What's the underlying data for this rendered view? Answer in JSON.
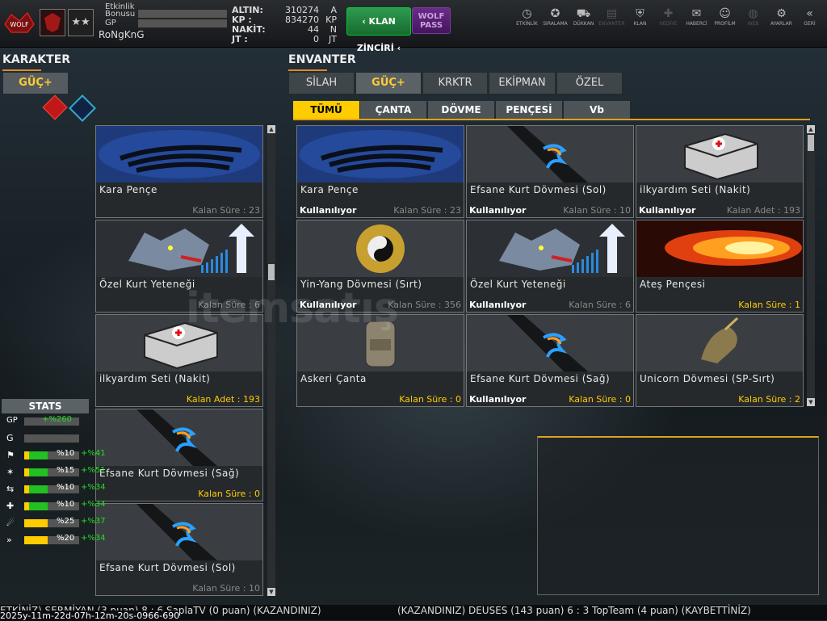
{
  "header": {
    "bonus_label": "Etkinlik\nBonusu",
    "gp_label": "GP",
    "username": "RoNgKnG",
    "currencies": [
      {
        "label": "ALTIN:",
        "value": "310274",
        "unit": "A"
      },
      {
        "label": "KP :",
        "value": "834270",
        "unit": "KP"
      },
      {
        "label": "NAKİT:",
        "value": "44",
        "unit": "N"
      },
      {
        "label": "JT :",
        "value": "0",
        "unit": "JT"
      }
    ],
    "klan_button": "‹ KLAN ZİNCİRİ ‹",
    "wolf_button": "WOLF\nPASS",
    "icons": [
      {
        "label": "ETKİNLİK",
        "icon": "clock-icon",
        "glyph": "◷",
        "dim": false
      },
      {
        "label": "SIRALAMA",
        "icon": "medal-icon",
        "glyph": "✪",
        "dim": false
      },
      {
        "label": "DÜKKAN",
        "icon": "cart-icon",
        "glyph": "⛟",
        "dim": false
      },
      {
        "label": "ENVANTER",
        "icon": "inventory-icon",
        "glyph": "▤",
        "dim": true
      },
      {
        "label": "KLAN",
        "icon": "shield-icon",
        "glyph": "⛨",
        "dim": false
      },
      {
        "label": "HEDİYE",
        "icon": "gift-icon",
        "glyph": "✚",
        "dim": true
      },
      {
        "label": "HABERCİ",
        "icon": "megaphone-icon",
        "glyph": "✉",
        "dim": false
      },
      {
        "label": "PROFİLM",
        "icon": "profile-icon",
        "glyph": "☺",
        "dim": false
      },
      {
        "label": "WEB",
        "icon": "globe-icon",
        "glyph": "◍",
        "dim": true
      },
      {
        "label": "AYARLAR",
        "icon": "gear-icon",
        "glyph": "⚙",
        "dim": false
      },
      {
        "label": "GERİ",
        "icon": "back-icon",
        "glyph": "«",
        "dim": false
      }
    ]
  },
  "karakter": {
    "title": "KARAKTER",
    "tab": "GÜÇ+",
    "cards": [
      {
        "name": "Kara Pençe",
        "remaining": "Kalan Süre : 23",
        "yellow": false,
        "img": "claw"
      },
      {
        "name": "Özel Kurt Yeteneği",
        "remaining": "Kalan Süre : 6",
        "yellow": false,
        "img": "wolf"
      },
      {
        "name": "ilkyardım Seti (Nakit)",
        "remaining": "Kalan Adet : 193",
        "yellow": true,
        "img": "medkit"
      },
      {
        "name": "Efsane Kurt Dövmesi (Sağ)",
        "remaining": "Kalan Süre : 0",
        "yellow": true,
        "img": "tattoo"
      },
      {
        "name": "Efsane Kurt Dövmesi (Sol)",
        "remaining": "Kalan Süre : 10",
        "yellow": false,
        "img": "tattoo"
      }
    ]
  },
  "stats": {
    "title": "STATS",
    "rows": [
      {
        "icon": "GP",
        "pct": "+%260",
        "plus": "",
        "fill": 0,
        "color": "#1c3",
        "type": "gp"
      },
      {
        "icon": "G",
        "pct": "",
        "plus": "",
        "fill": 0,
        "color": "#1c3",
        "type": "g"
      },
      {
        "icon": "⚑",
        "pct": "%10",
        "plus": "+%41",
        "fill": 0.42,
        "color": "#22c022",
        "type": "stat"
      },
      {
        "icon": "✶",
        "pct": "%15",
        "plus": "+%51",
        "fill": 0.42,
        "color": "#22c022",
        "type": "stat"
      },
      {
        "icon": "⇆",
        "pct": "%10",
        "plus": "+%34",
        "fill": 0.42,
        "color": "#22c022",
        "type": "stat"
      },
      {
        "icon": "✚",
        "pct": "%10",
        "plus": "+%34",
        "fill": 0.42,
        "color": "#22c022",
        "type": "stat"
      },
      {
        "icon": "☄",
        "pct": "%25",
        "plus": "+%37",
        "fill": 0.42,
        "color": "#ffcc00",
        "type": "stat"
      },
      {
        "icon": "»",
        "pct": "%20",
        "plus": "+%34",
        "fill": 0.42,
        "color": "#ffcc00",
        "type": "stat"
      }
    ]
  },
  "envanter": {
    "title": "ENVANTER",
    "tabs": [
      "SİLAH",
      "GÜÇ+",
      "KRKTR",
      "EKİPMAN",
      "ÖZEL"
    ],
    "active_tab": 1,
    "subtabs": [
      "TÜMÜ",
      "ÇANTA",
      "DÖVME",
      "PENÇESİ",
      "Vb"
    ],
    "active_subtab": 0,
    "items": [
      {
        "name": "Kara Pençe",
        "status": "Kullanılıyor",
        "remaining": "Kalan Süre : 23",
        "yellow": false,
        "img": "claw"
      },
      {
        "name": "Efsane Kurt Dövmesi (Sol)",
        "status": "Kullanılıyor",
        "remaining": "Kalan Süre : 10",
        "yellow": false,
        "img": "tattoo"
      },
      {
        "name": "ilkyardım Seti (Nakit)",
        "status": "Kullanılıyor",
        "remaining": "Kalan Adet : 193",
        "yellow": false,
        "img": "medkit"
      },
      {
        "name": "Yin-Yang Dövmesi (Sırt)",
        "status": "Kullanılıyor",
        "remaining": "Kalan Süre : 356",
        "yellow": false,
        "img": "dragon"
      },
      {
        "name": "Özel Kurt Yeteneği",
        "status": "Kullanılıyor",
        "remaining": "Kalan Süre : 6",
        "yellow": false,
        "img": "wolf"
      },
      {
        "name": "Ateş Pençesi",
        "status": "",
        "remaining": "Kalan Süre : 1",
        "yellow": true,
        "img": "fire"
      },
      {
        "name": "Askeri Çanta",
        "status": "",
        "remaining": "Kalan Süre : 0",
        "yellow": true,
        "img": "bag"
      },
      {
        "name": "Efsane Kurt Dövmesi (Sağ)",
        "status": "Kullanılıyor",
        "remaining": "Kalan Süre : 0",
        "yellow": true,
        "img": "tattoo"
      },
      {
        "name": "Unicorn Dövmesi (SP-Sırt)",
        "status": "",
        "remaining": "Kalan Süre : 2",
        "yellow": true,
        "img": "unicorn"
      }
    ]
  },
  "ticker": {
    "line1": "ETKİNİZ) SERMİYAN (3 puan) 8 : 6 SaplaTV (0 puan) (KAZANDINIZ)",
    "line2": "(KAZANDINIZ) DEUSES (143 puan) 6 : 3 TopTeam (4 puan) (KAYBETTİNİZ)",
    "timestamp": "2025y-11m-22d-07h-12m-20s-0966-690"
  },
  "watermark": "itemsatış"
}
